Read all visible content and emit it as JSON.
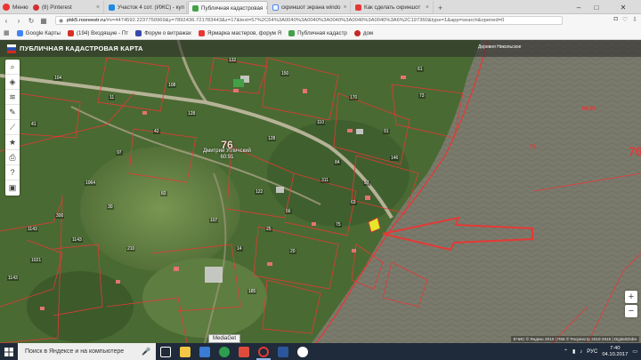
{
  "browser": {
    "menu_label": "Меню",
    "tabs": [
      {
        "label": "(8) Pinterest",
        "color": "#d32f2f"
      },
      {
        "label": "Участок 4 сот. (ИЖС) - куп",
        "color": "#1e88e5"
      },
      {
        "label": "Публичная кадастровая",
        "color": "#43a047",
        "active": true
      },
      {
        "label": "скриншот экрана windo",
        "color": "#fbc02d"
      },
      {
        "label": "Как сделать скриншот",
        "color": "#e53935"
      }
    ],
    "url_host": "pkk5.rosreestr.ru",
    "url_rest": "/#x=4474592.2237750969&y=7892436.721783443&z=17&text=57%2C64%3A0040%3A0040%3A0040%3A0040%3A0040%3A6%2C197360&type=1&app=search&opened=0",
    "bookmarks": [
      {
        "label": "Google Карты",
        "color": "#4285f4"
      },
      {
        "label": "(194) Входящие - Пт",
        "color": "#d93025"
      },
      {
        "label": "Форум о витражах",
        "color": "#3949ab"
      },
      {
        "label": "Ярмарка мастеров, форум Я",
        "color": "#e53935"
      },
      {
        "label": "Публичная кадастр",
        "color": "#43a047"
      },
      {
        "label": "дом",
        "color": "#c62828"
      }
    ]
  },
  "map": {
    "title": "ПУБЛИЧНАЯ КАДАСТРОВАЯ КАРТА",
    "tools": [
      "search-icon",
      "layers-icon",
      "stack-icon",
      "pencil-icon",
      "ruler-icon",
      "star-icon",
      "print-icon",
      "help-icon",
      "settings-icon"
    ],
    "quarter_number": "76",
    "quarter_name": "Дмитрий Угличский",
    "quarter_code": "60:91",
    "right_number": "76",
    "lake_code": "68:91",
    "top_label": "Деревня Никольское",
    "attribution": "ЕЧИС © Яндекс 2010 | ПКК © Росреестр 2010-2015 | DigitalGlobe",
    "zoom_in": "+",
    "zoom_out": "−",
    "parcel_labels": [
      "104",
      "150",
      "41",
      "42",
      "1064",
      "128",
      "300",
      "1143",
      "1143",
      "1143",
      "128",
      "110",
      "122",
      "57",
      "63",
      "75",
      "25",
      "20",
      "210",
      "1021",
      "108",
      "107",
      "170",
      "91",
      "61",
      "11",
      "97",
      "185",
      "311",
      "146",
      "73",
      "84",
      "56",
      "14",
      "30",
      "82",
      "132",
      "76"
    ]
  },
  "taskbar": {
    "search_placeholder": "Поиск в Яндексе и на компьютере",
    "tooltip": "MediaGet",
    "lang": "РУС",
    "time": "7:40",
    "date": "04.10.2017"
  }
}
